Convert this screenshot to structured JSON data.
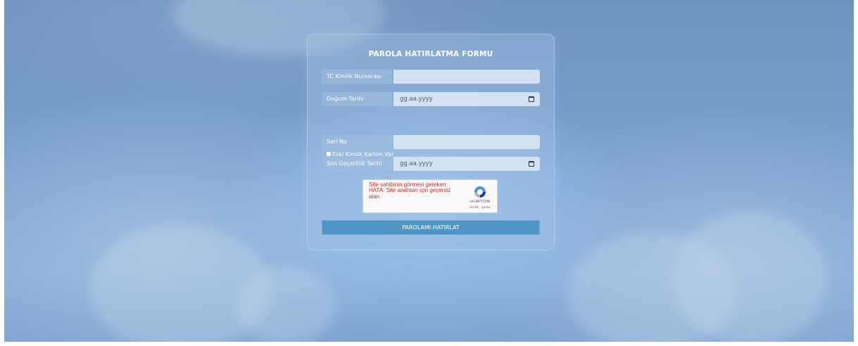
{
  "form": {
    "title": "PAROLA HATIRLATMA FORMU",
    "tc_label": "TC Kimlik Numarası",
    "tc_value": "",
    "birth_label": "Doğum Tarihi",
    "birth_placeholder": "gg.aa.yyyy",
    "old_id_label": "Eski Kimlik Kartım Var",
    "old_id_checked": false,
    "serial_label": "Seri No",
    "serial_value": "",
    "expiry_label": "Son Geçerlilik Tarihi",
    "expiry_placeholder": "gg.aa.yyyy",
    "submit_label": "PAROLAMI HATIRLAT"
  },
  "recaptcha": {
    "error_text": "Site sahibinin görmesi gereken HATA: Site anahtarı için geçersiz alan",
    "brand": "reCAPTCHA",
    "terms": "Gizlilik - Şartlar"
  },
  "colors": {
    "submit": "#4f96c6",
    "error": "#d9271e",
    "field": "#d4e1f1"
  }
}
